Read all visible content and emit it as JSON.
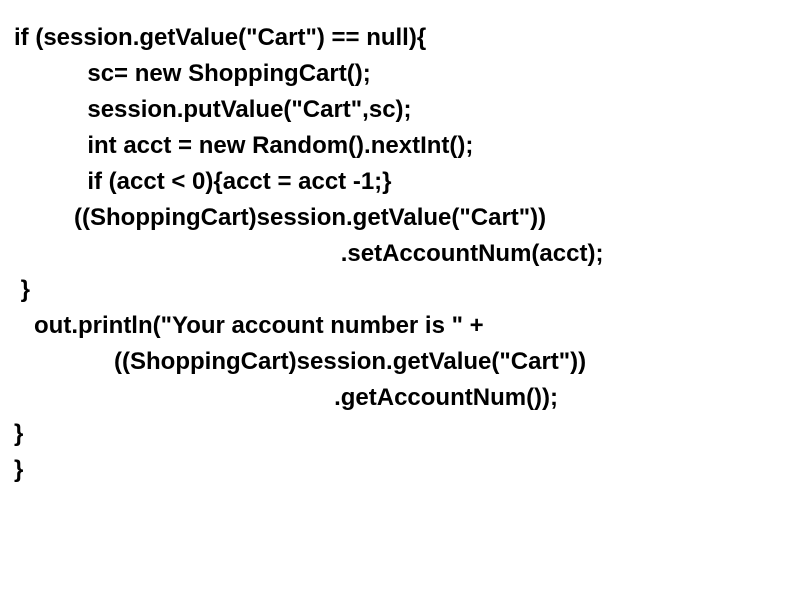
{
  "code": {
    "lines": [
      "if (session.getValue(\"Cart\") == null){",
      "           sc= new ShoppingCart();",
      "           session.putValue(\"Cart\",sc);",
      "           int acct = new Random().nextInt();",
      "           if (acct < 0){acct = acct -1;}",
      "         ((ShoppingCart)session.getValue(\"Cart\"))",
      "                                                 .setAccountNum(acct);",
      " }",
      "   out.println(\"Your account number is \" +",
      "               ((ShoppingCart)session.getValue(\"Cart\"))",
      "                                                .getAccountNum());",
      "}",
      "}"
    ]
  }
}
